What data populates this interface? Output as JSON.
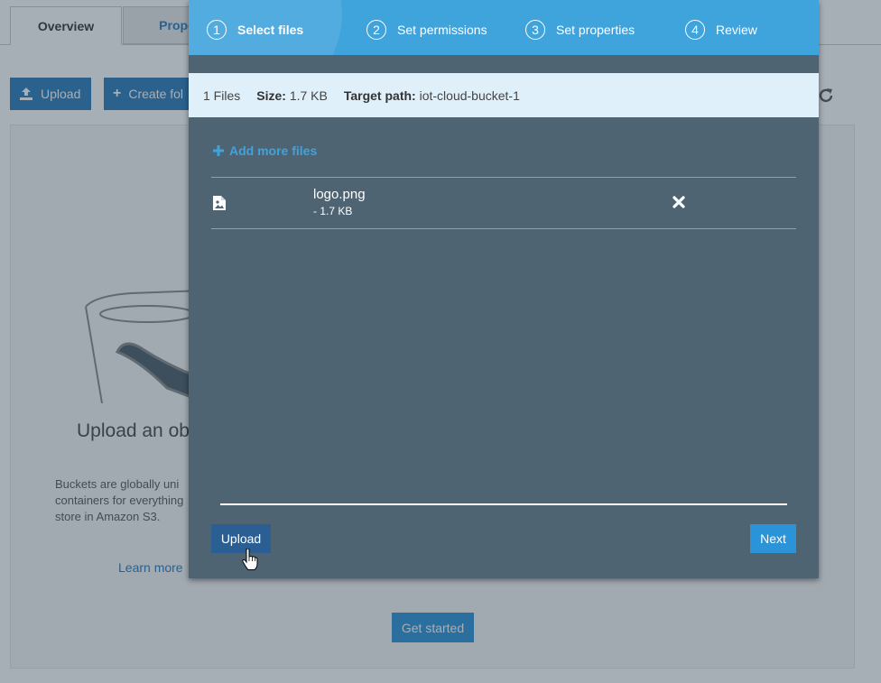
{
  "background": {
    "tabs": [
      {
        "label": "Overview"
      },
      {
        "label": "Prope"
      }
    ],
    "toolbar": {
      "upload_label": "Upload",
      "create_folder_label": "Create fol"
    },
    "empty_state": {
      "title": "Upload an ob",
      "description": "Buckets are globally uni containers for everything store in Amazon S3.",
      "learn_more": "Learn more",
      "get_started": "Get started"
    }
  },
  "wizard": {
    "steps": [
      {
        "number": "1",
        "label": "Select files",
        "active": true
      },
      {
        "number": "2",
        "label": "Set permissions",
        "active": false
      },
      {
        "number": "3",
        "label": "Set properties",
        "active": false
      },
      {
        "number": "4",
        "label": "Review",
        "active": false
      }
    ],
    "summary": {
      "files_count": "1 Files",
      "size_label": "Size:",
      "size_value": "1.7 KB",
      "target_label": "Target path:",
      "target_value": "iot-cloud-bucket-1"
    },
    "add_more_files": "Add more files",
    "files": [
      {
        "name": "logo.png",
        "size": "- 1.7 KB",
        "icon": "image-file-icon"
      }
    ],
    "buttons": {
      "upload": "Upload",
      "next": "Next"
    }
  },
  "colors": {
    "step_bar": "#3fa3dc",
    "modal_bg": "#4f6472",
    "info_bar": "#dff0fa",
    "upload_button": "#2b5f94",
    "next_button": "#2b93d8"
  }
}
